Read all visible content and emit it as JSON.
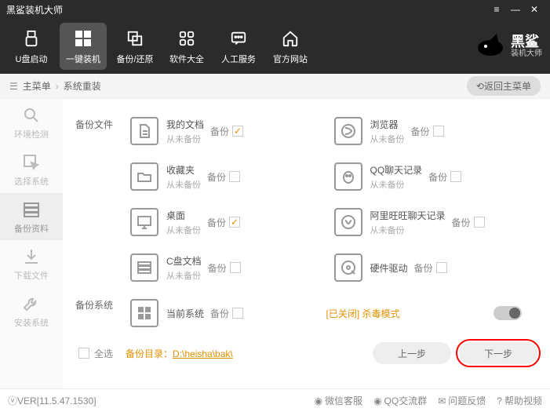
{
  "window": {
    "title": "黑鲨装机大师"
  },
  "nav": {
    "items": [
      {
        "label": "U盘启动"
      },
      {
        "label": "一键装机"
      },
      {
        "label": "备份/还原"
      },
      {
        "label": "软件大全"
      },
      {
        "label": "人工服务"
      },
      {
        "label": "官方网站"
      }
    ],
    "brand_name": "黑鲨",
    "brand_sub": "装机大师"
  },
  "breadcrumb": {
    "root": "主菜单",
    "current": "系统重装",
    "back": "返回主菜单"
  },
  "sidebar": {
    "items": [
      {
        "label": "环境检测"
      },
      {
        "label": "选择系统"
      },
      {
        "label": "备份资料"
      },
      {
        "label": "下载文件"
      },
      {
        "label": "安装系统"
      }
    ]
  },
  "sections": {
    "files": "备份文件",
    "system": "备份系统"
  },
  "backup_label": "备份",
  "items": {
    "docs": {
      "title": "我的文档",
      "sub": "从未备份",
      "checked": true
    },
    "browser": {
      "title": "浏览器",
      "sub": "从未备份",
      "checked": false
    },
    "fav": {
      "title": "收藏夹",
      "sub": "从未备份",
      "checked": false
    },
    "qq": {
      "title": "QQ聊天记录",
      "sub": "从未备份",
      "checked": false
    },
    "desktop": {
      "title": "桌面",
      "sub": "从未备份",
      "checked": true
    },
    "ali": {
      "title": "阿里旺旺聊天记录",
      "sub": "从未备份",
      "checked": false
    },
    "cdisk": {
      "title": "C盘文档",
      "sub": "从未备份",
      "checked": false
    },
    "driver": {
      "title": "硬件驱动",
      "sub": "",
      "checked": false
    },
    "cursys": {
      "title": "当前系统",
      "sub": "",
      "checked": false
    }
  },
  "kill_mode": {
    "label": "[已关闭] 杀毒模式"
  },
  "footer": {
    "select_all": "全选",
    "path_label": "备份目录：",
    "path": "D:\\heisha\\bak\\",
    "prev": "上一步",
    "next": "下一步"
  },
  "status": {
    "version": "VER[11.5.47.1530]",
    "links": [
      {
        "label": "微信客服"
      },
      {
        "label": "QQ交流群"
      },
      {
        "label": "问题反馈"
      },
      {
        "label": "帮助视频"
      }
    ]
  }
}
